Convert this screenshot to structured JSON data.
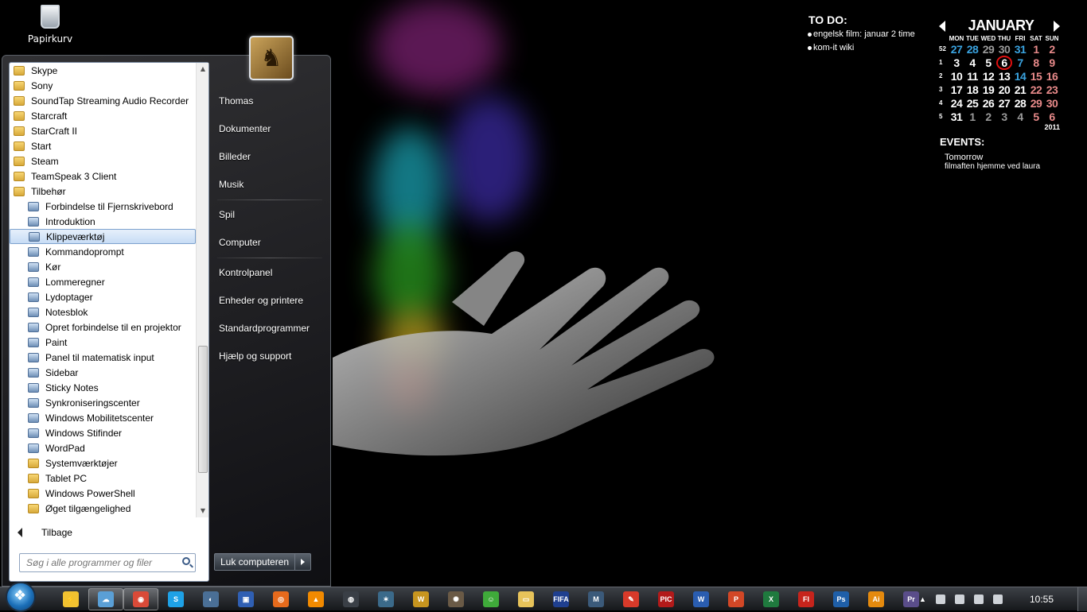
{
  "desktop": {
    "recycle_bin_label": "Papirkurv"
  },
  "start_menu": {
    "programs": [
      {
        "label": "Skype",
        "type": "folder"
      },
      {
        "label": "Sony",
        "type": "folder"
      },
      {
        "label": "SoundTap Streaming Audio Recorder",
        "type": "folder"
      },
      {
        "label": "Starcraft",
        "type": "folder"
      },
      {
        "label": "StarCraft II",
        "type": "folder"
      },
      {
        "label": "Start",
        "type": "folder"
      },
      {
        "label": "Steam",
        "type": "folder"
      },
      {
        "label": "TeamSpeak 3 Client",
        "type": "folder"
      },
      {
        "label": "Tilbehør",
        "type": "folder"
      },
      {
        "label": "Forbindelse til Fjernskrivebord",
        "type": "app"
      },
      {
        "label": "Introduktion",
        "type": "app"
      },
      {
        "label": "Klippeværktøj",
        "type": "app",
        "selected": true
      },
      {
        "label": "Kommandoprompt",
        "type": "app"
      },
      {
        "label": "Kør",
        "type": "app"
      },
      {
        "label": "Lommeregner",
        "type": "app"
      },
      {
        "label": "Lydoptager",
        "type": "app"
      },
      {
        "label": "Notesblok",
        "type": "app"
      },
      {
        "label": "Opret forbindelse til en projektor",
        "type": "app"
      },
      {
        "label": "Paint",
        "type": "app"
      },
      {
        "label": "Panel til matematisk input",
        "type": "app"
      },
      {
        "label": "Sidebar",
        "type": "app"
      },
      {
        "label": "Sticky Notes",
        "type": "app"
      },
      {
        "label": "Synkroniseringscenter",
        "type": "app"
      },
      {
        "label": "Windows Mobilitetscenter",
        "type": "app"
      },
      {
        "label": "Windows Stifinder",
        "type": "app"
      },
      {
        "label": "WordPad",
        "type": "app"
      },
      {
        "label": "Systemværktøjer",
        "type": "folder",
        "indent": true
      },
      {
        "label": "Tablet PC",
        "type": "folder",
        "indent": true
      },
      {
        "label": "Windows PowerShell",
        "type": "folder",
        "indent": true
      },
      {
        "label": "Øget tilgængelighed",
        "type": "folder",
        "indent": true
      }
    ],
    "back_label": "Tilbage",
    "search_placeholder": "Søg i alle programmer og filer",
    "right_items": [
      {
        "label": "Thomas"
      },
      {
        "label": "Dokumenter"
      },
      {
        "label": "Billeder"
      },
      {
        "label": "Musik"
      },
      {
        "label": "Spil",
        "sep_before": true
      },
      {
        "label": "Computer"
      },
      {
        "label": "Kontrolpanel",
        "sep_before": true
      },
      {
        "label": "Enheder og printere"
      },
      {
        "label": "Standardprogrammer"
      },
      {
        "label": "Hjælp og support"
      }
    ],
    "shutdown_label": "Luk computeren"
  },
  "todo": {
    "title": "TO DO:",
    "items": [
      "engelsk film: januar 2 time",
      "kom-it wiki"
    ]
  },
  "calendar": {
    "month": "JANUARY",
    "year": "2011",
    "weekdays": [
      "MON",
      "TUE",
      "WED",
      "THU",
      "FRI",
      "SAT",
      "SUN"
    ],
    "weeks": [
      {
        "wk": "52",
        "days": [
          "27",
          "28",
          "29",
          "30",
          "31",
          "1",
          "2"
        ]
      },
      {
        "wk": "1",
        "days": [
          "3",
          "4",
          "5",
          "6",
          "7",
          "8",
          "9"
        ]
      },
      {
        "wk": "2",
        "days": [
          "10",
          "11",
          "12",
          "13",
          "14",
          "15",
          "16"
        ]
      },
      {
        "wk": "3",
        "days": [
          "17",
          "18",
          "19",
          "20",
          "21",
          "22",
          "23"
        ]
      },
      {
        "wk": "4",
        "days": [
          "24",
          "25",
          "26",
          "27",
          "28",
          "29",
          "30"
        ]
      },
      {
        "wk": "5",
        "days": [
          "31",
          "1",
          "2",
          "3",
          "4",
          "5",
          "6"
        ]
      }
    ],
    "today": "6",
    "events_title": "EVENTS:",
    "event_when": "Tomorrow",
    "event_text": "filmaften hjemme ved laura"
  },
  "taskbar": {
    "icons": [
      {
        "name": "winamp-icon",
        "color": "#f2c230",
        "glyph": "⚡"
      },
      {
        "name": "network-icon",
        "color": "#5a9fd6",
        "glyph": "☁",
        "active": true
      },
      {
        "name": "chrome-icon",
        "color": "#d94a38",
        "glyph": "◉",
        "active": true
      },
      {
        "name": "skype-icon",
        "color": "#1ea1e6",
        "glyph": "S"
      },
      {
        "name": "media-icon",
        "color": "#4a6f96",
        "glyph": "◐"
      },
      {
        "name": "app-icon",
        "color": "#2f5fb3",
        "glyph": "▣"
      },
      {
        "name": "firefox-icon",
        "color": "#e66a1c",
        "glyph": "◎"
      },
      {
        "name": "vlc-icon",
        "color": "#f28a00",
        "glyph": "▲"
      },
      {
        "name": "steam-icon",
        "color": "#3a3f46",
        "glyph": "◍"
      },
      {
        "name": "starcraft-icon",
        "color": "#3b6a8a",
        "glyph": "✶"
      },
      {
        "name": "wow-icon",
        "color": "#c7951f",
        "glyph": "W"
      },
      {
        "name": "starcraft2-icon",
        "color": "#6a5a46",
        "glyph": "✺"
      },
      {
        "name": "messenger-icon",
        "color": "#3faa3a",
        "glyph": "☺"
      },
      {
        "name": "explorer-icon",
        "color": "#e7c35a",
        "glyph": "▭"
      },
      {
        "name": "eve-icon",
        "color": "#1f3f8f",
        "glyph": "FIFA"
      },
      {
        "name": "mpc-icon",
        "color": "#3b5a7a",
        "glyph": "M"
      },
      {
        "name": "tool-icon",
        "color": "#d83a2a",
        "glyph": "✎"
      },
      {
        "name": "picasa-icon",
        "color": "#b21a1a",
        "glyph": "PIC"
      },
      {
        "name": "word-icon",
        "color": "#2a5db0",
        "glyph": "W"
      },
      {
        "name": "powerpoint-icon",
        "color": "#d24726",
        "glyph": "P"
      },
      {
        "name": "excel-icon",
        "color": "#1f7a3e",
        "glyph": "X"
      },
      {
        "name": "flash-icon",
        "color": "#c6241c",
        "glyph": "Fl"
      },
      {
        "name": "photoshop-icon",
        "color": "#1f5fa8",
        "glyph": "Ps"
      },
      {
        "name": "illustrator-icon",
        "color": "#e58a0e",
        "glyph": "Ai"
      },
      {
        "name": "premiere-icon",
        "color": "#5a4d8a",
        "glyph": "Pr"
      }
    ],
    "clock": "10:55"
  }
}
